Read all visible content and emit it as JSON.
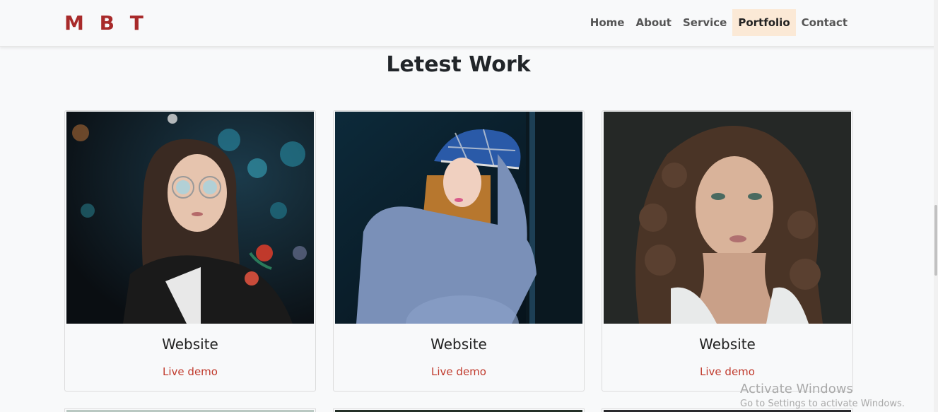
{
  "brand": "M B T",
  "nav": [
    {
      "label": "Home",
      "active": false
    },
    {
      "label": "About",
      "active": false
    },
    {
      "label": "Service",
      "active": false
    },
    {
      "label": "Portfolio",
      "active": true
    },
    {
      "label": "Contact",
      "active": false
    }
  ],
  "section_title": "Letest Work",
  "cards": [
    {
      "title": "Website",
      "link": "Live demo"
    },
    {
      "title": "Website",
      "link": "Live demo"
    },
    {
      "title": "Website",
      "link": "Live demo"
    }
  ],
  "watermark": {
    "line1": "Activate Windows",
    "line2": "Go to Settings to activate Windows."
  },
  "colors": {
    "brand": "#a82a2a",
    "active_nav_bg": "#fbe9d6",
    "link": "#c0392b",
    "background": "#f8f9fa"
  }
}
